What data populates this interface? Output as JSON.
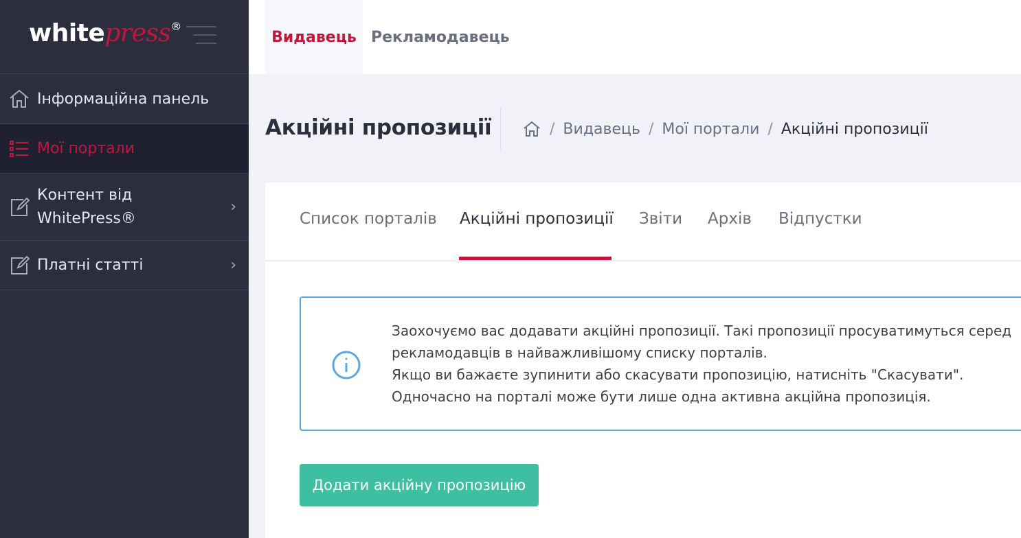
{
  "brand": {
    "logo_white": "white",
    "logo_press": "press",
    "logo_reg": "®",
    "accent_color": "#c4163d",
    "sidebar_color": "#2c2e3e",
    "button_color": "#3ebfa1",
    "info_border_color": "#5ba7e4"
  },
  "sidebar": {
    "items": [
      {
        "label": "Інформаційна панель",
        "icon": "home-icon",
        "active": false
      },
      {
        "label": "Мої портали",
        "icon": "list-icon",
        "active": true
      },
      {
        "label": "Контент від",
        "label2": "WhitePress®",
        "icon": "edit-icon",
        "chevron": "›"
      },
      {
        "label": "Платні статті",
        "icon": "edit-icon",
        "chevron": "›"
      }
    ]
  },
  "topbar": {
    "tabs": [
      {
        "label": "Видавець",
        "active": true
      },
      {
        "label": "Рекламодавець",
        "active": false
      }
    ]
  },
  "subheader": {
    "title": "Акційні пропозиції",
    "breadcrumb": [
      {
        "label": "Видавець"
      },
      {
        "label": "Мої портали"
      },
      {
        "label": "Акційні пропозиції"
      }
    ],
    "separator": "/"
  },
  "main": {
    "tabs": [
      {
        "label": "Список порталів",
        "active": false
      },
      {
        "label": "Акційні пропозиції",
        "active": true
      },
      {
        "label": "Звіти",
        "active": false
      },
      {
        "label": "Архів",
        "active": false
      },
      {
        "label": "Відпустки",
        "active": false
      }
    ],
    "info": {
      "lines": [
        "Заохочуємо вас додавати акційні пропозиції. Такі пропозиції просуватимуться серед",
        "рекламодавців в найважливішому списку порталів.",
        "Якщо ви бажаєте зупинити або скасувати пропозицію, натисніть \"Скасувати\".",
        "Одночасно на порталі може бути лише одна активна акційна пропозиція."
      ],
      "icon": "info-icon"
    },
    "add_button": "Додати акційну пропозицію"
  }
}
